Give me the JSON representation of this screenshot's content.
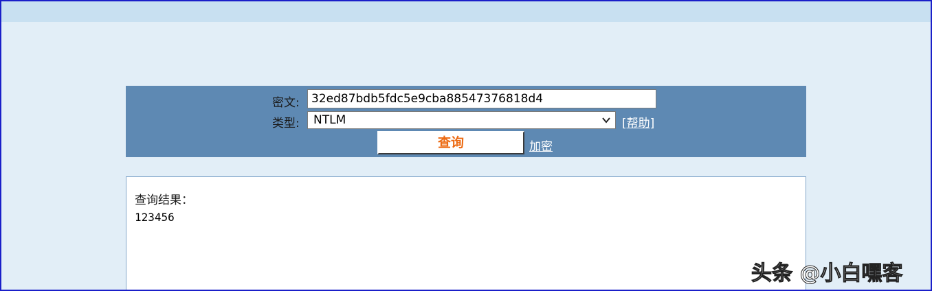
{
  "form": {
    "cipher_label": "密文:",
    "cipher_value": "32ed87bdb5fdc5e9cba88547376818d4",
    "type_label": "类型:",
    "type_selected": "NTLM",
    "help_link": "[帮助]",
    "query_button": "查询",
    "encrypt_link": "加密"
  },
  "result": {
    "title": "查询结果：",
    "value": "123456"
  },
  "watermark": "头条 @小白嘿客",
  "colors": {
    "page_background": "#e2eef7",
    "top_bar": "#c8e0f1",
    "panel": "#5e89b3",
    "query_button_text": "#ec6a12",
    "frame_border": "#1a1fc9"
  }
}
